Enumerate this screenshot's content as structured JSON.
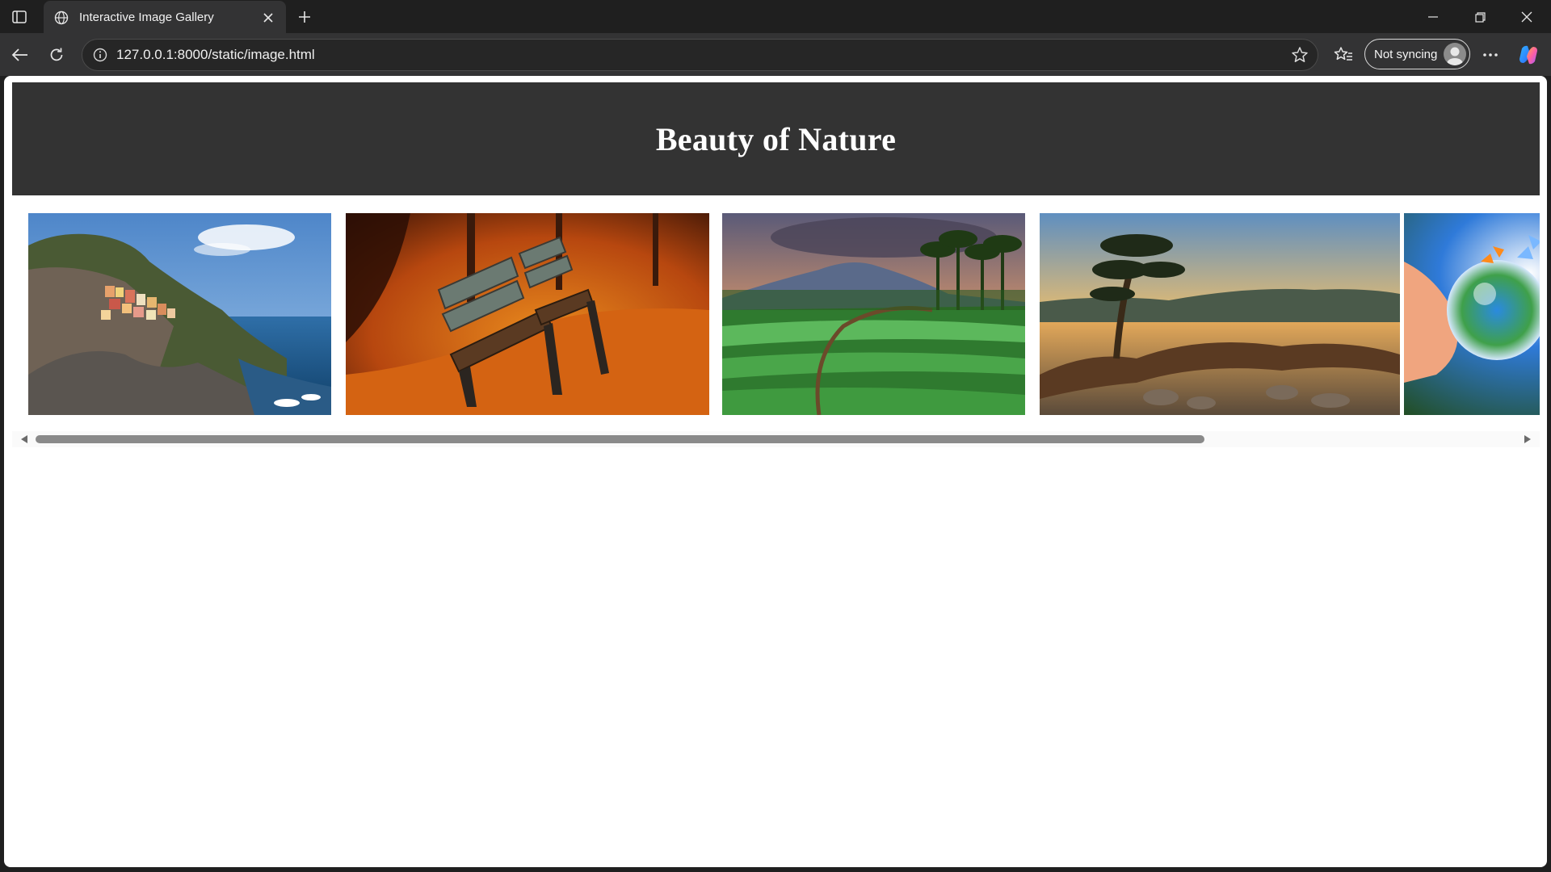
{
  "browser": {
    "tab": {
      "title": "Interactive Image Gallery",
      "favicon": "globe-icon"
    },
    "address_bar": {
      "url": "127.0.0.1:8000/static/image.html"
    },
    "profile": {
      "label": "Not syncing"
    },
    "icons": [
      "sidebar-toggle-icon",
      "globe-icon",
      "close-icon",
      "plus-icon",
      "minimize-icon",
      "restore-icon",
      "back-arrow-icon",
      "refresh-icon",
      "info-icon",
      "star-icon",
      "favorites-icon",
      "more-icon",
      "copilot-icon"
    ]
  },
  "page": {
    "title": "Beauty of Nature",
    "header_bg": "#333333",
    "gallery": {
      "images": [
        {
          "name": "coastal-village-image",
          "description_icon": "cliffside village by the sea"
        },
        {
          "name": "autumn-bench-image",
          "description_icon": "benches on autumn leaves"
        },
        {
          "name": "rice-terrace-image",
          "description_icon": "green rice terraces and mountain"
        },
        {
          "name": "lake-tree-image",
          "description_icon": "tree over lake at sunset"
        },
        {
          "name": "crystal-ball-image",
          "description_icon": "hand holding glass globe with butterflies"
        }
      ]
    },
    "scrollbar": {
      "position_fraction": 0.0,
      "visible_fraction": 0.77
    }
  }
}
